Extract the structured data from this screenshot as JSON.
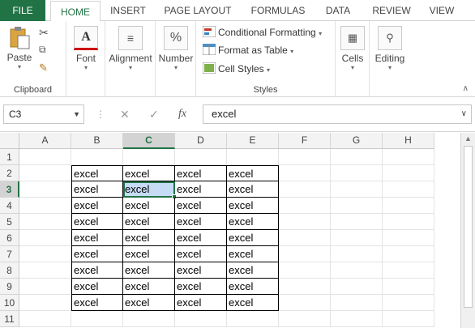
{
  "tabs": [
    {
      "label": "FILE"
    },
    {
      "label": "HOME"
    },
    {
      "label": "INSERT"
    },
    {
      "label": "PAGE LAYOUT"
    },
    {
      "label": "FORMULAS"
    },
    {
      "label": "DATA"
    },
    {
      "label": "REVIEW"
    },
    {
      "label": "VIEW"
    }
  ],
  "ribbon": {
    "clipboard": {
      "paste": "Paste",
      "group": "Clipboard"
    },
    "font": {
      "label": "Font"
    },
    "alignment": {
      "label": "Alignment"
    },
    "number": {
      "label": "Number",
      "icon": "%"
    },
    "styles": {
      "conditional": "Conditional Formatting",
      "table": "Format as Table",
      "cellstyles": "Cell Styles",
      "group": "Styles"
    },
    "cells": {
      "label": "Cells"
    },
    "editing": {
      "label": "Editing"
    }
  },
  "formula_bar": {
    "name_box": "C3",
    "fx": "fx",
    "content": "excel"
  },
  "sheet": {
    "columns": [
      "A",
      "B",
      "C",
      "D",
      "E",
      "F",
      "G",
      "H"
    ],
    "rows": [
      "1",
      "2",
      "3",
      "4",
      "5",
      "6",
      "7",
      "8",
      "9",
      "10",
      "11"
    ],
    "selected_col": "C",
    "selected_row": "3",
    "cells": [
      [
        "excel",
        "excel",
        "excel",
        "excel"
      ],
      [
        "excel",
        "excel",
        "excel",
        "excel"
      ],
      [
        "excel",
        "excel",
        "excel",
        "excel"
      ],
      [
        "excel",
        "excel",
        "excel",
        "excel"
      ],
      [
        "excel",
        "excel",
        "excel",
        "excel"
      ],
      [
        "excel",
        "excel",
        "excel",
        "excel"
      ],
      [
        "excel",
        "excel",
        "excel",
        "excel"
      ],
      [
        "excel",
        "excel",
        "excel",
        "excel"
      ],
      [
        "excel",
        "excel",
        "excel",
        "excel"
      ]
    ]
  },
  "colors": {
    "accent": "#217346",
    "selection": "#c6dcf5"
  }
}
